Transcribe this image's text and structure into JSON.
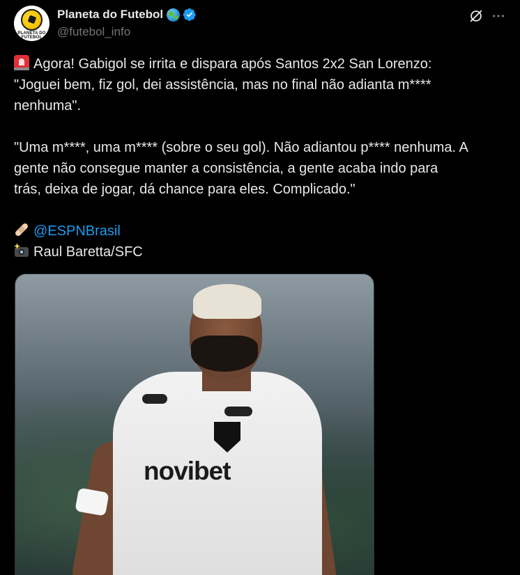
{
  "author": {
    "display_name": "Planeta do Futebol",
    "handle": "@futebol_info",
    "avatar_text": "PLANETA DO FUTEBOL",
    "badge": "verified-icon",
    "emoji": "globe-icon"
  },
  "post": {
    "line1": "Agora! Gabigol se irrita e dispara após Santos 2x2 San Lorenzo:",
    "line2": "\"Joguei bem, fiz gol, dei assistência, mas no final não adianta m****",
    "line3": "nenhuma\".",
    "line4": "\"Uma m****, uma m**** (sobre o seu gol). Não adiantou p**** nenhuma. A",
    "line5": "gente não consegue manter a consistência, a gente acaba indo para",
    "line6": "trás, deixa de jogar, dá chance para eles. Complicado.\"",
    "credit_mention": "@ESPNBrasil",
    "credit_photo": "Raul Baretta/SFC"
  },
  "photo": {
    "sponsor": "novibet"
  },
  "colors": {
    "background": "#000000",
    "text": "#e7e9ea",
    "secondary": "#71767b",
    "link": "#1d9bf0"
  }
}
